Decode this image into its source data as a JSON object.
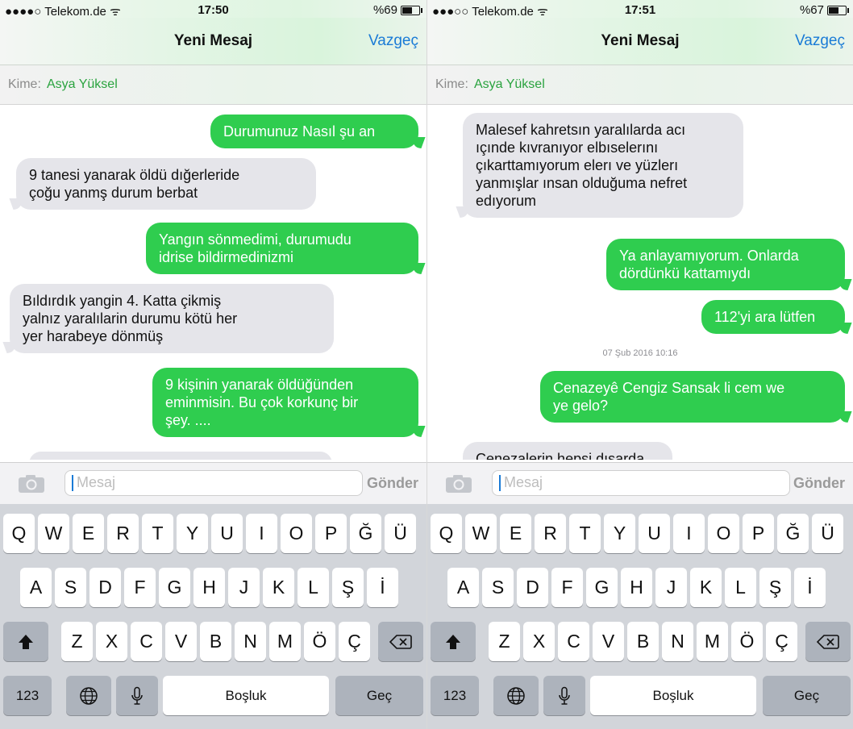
{
  "screens": [
    {
      "status": {
        "carrier": "●●●●○ Telekom.de",
        "wifi": "ᯤ",
        "time": "17:50",
        "battery_text": "%69",
        "battery_level": 0.69
      },
      "nav": {
        "title": "Yeni Mesaj",
        "cancel": "Vazgeç"
      },
      "to": {
        "label": "Kime:",
        "recipient": "Asya Yüksel"
      },
      "messages": [
        {
          "dir": "out",
          "text": "Durumunuz Nasıl şu an"
        },
        {
          "dir": "in",
          "text": "9 tanesi  yanarak  öldü  dığerleride\nçoğu  yanmş  durum  berbat"
        },
        {
          "dir": "out",
          "text": "Yangın sönmedimi, durumudu\nidrise bildirmedinizmi"
        },
        {
          "dir": "in",
          "text": "Bıldırdık  yangin  4. Katta çikmiş\nyalnız  yaralılarin  durumu kötü  her\nyer harabeye  dönmüş"
        },
        {
          "dir": "out",
          "text": "9 kişinin yanarak öldüğünden\neminmisin. Bu çok korkunç bir\nşey. ...."
        }
      ],
      "compose": {
        "placeholder": "Mesaj",
        "send": "Gönder"
      }
    },
    {
      "status": {
        "carrier": "●●●○○ Telekom.de",
        "wifi": "ᯤ",
        "time": "17:51",
        "battery_text": "%67",
        "battery_level": 0.67
      },
      "nav": {
        "title": "Yeni Mesaj",
        "cancel": "Vazgeç"
      },
      "to": {
        "label": "Kime:",
        "recipient": "Asya Yüksel"
      },
      "messages": [
        {
          "dir": "in",
          "text": "Malesef  kahretsın  yaralılarda acı\nıçınde  kıvranıyor  elbıselerını\nçıkarttamıyorum  elerı ve yüzlerı\nyanmışlar  ınsan  olduğuma nefret\nedıyorum"
        },
        {
          "dir": "out",
          "text": "Ya anlayamıyorum. Onlarda\ndördünkü kattamıydı"
        },
        {
          "dir": "out",
          "text": "112'yi ara lütfen"
        },
        {
          "dir": "timestamp",
          "text": "07 Şub 2016 10:16"
        },
        {
          "dir": "out",
          "text": "Cenazeyê Cengiz Sansak li cem we\nye gelo?"
        },
        {
          "dir": "in",
          "text": "Cenezalerin hepsi dışarda"
        }
      ],
      "compose": {
        "placeholder": "Mesaj",
        "send": "Gönder"
      }
    }
  ],
  "keyboard": {
    "row1": [
      "Q",
      "W",
      "E",
      "R",
      "T",
      "Y",
      "U",
      "I",
      "O",
      "P",
      "Ğ",
      "Ü"
    ],
    "row2": [
      "A",
      "S",
      "D",
      "F",
      "G",
      "H",
      "J",
      "K",
      "L",
      "Ş",
      "İ"
    ],
    "row3": [
      "Z",
      "X",
      "C",
      "V",
      "B",
      "N",
      "M",
      "Ö",
      "Ç"
    ],
    "numbers": "123",
    "space": "Boşluk",
    "return": "Geç",
    "shift_icon": "shift-arrow-icon",
    "delete_icon": "backspace-icon",
    "globe_icon": "globe-icon",
    "mic_icon": "microphone-icon"
  },
  "colors": {
    "accent": "#1a7bd6",
    "outgoing": "#2fcd4f",
    "incoming": "#e5e5ea",
    "recipient": "#2aa33f"
  }
}
